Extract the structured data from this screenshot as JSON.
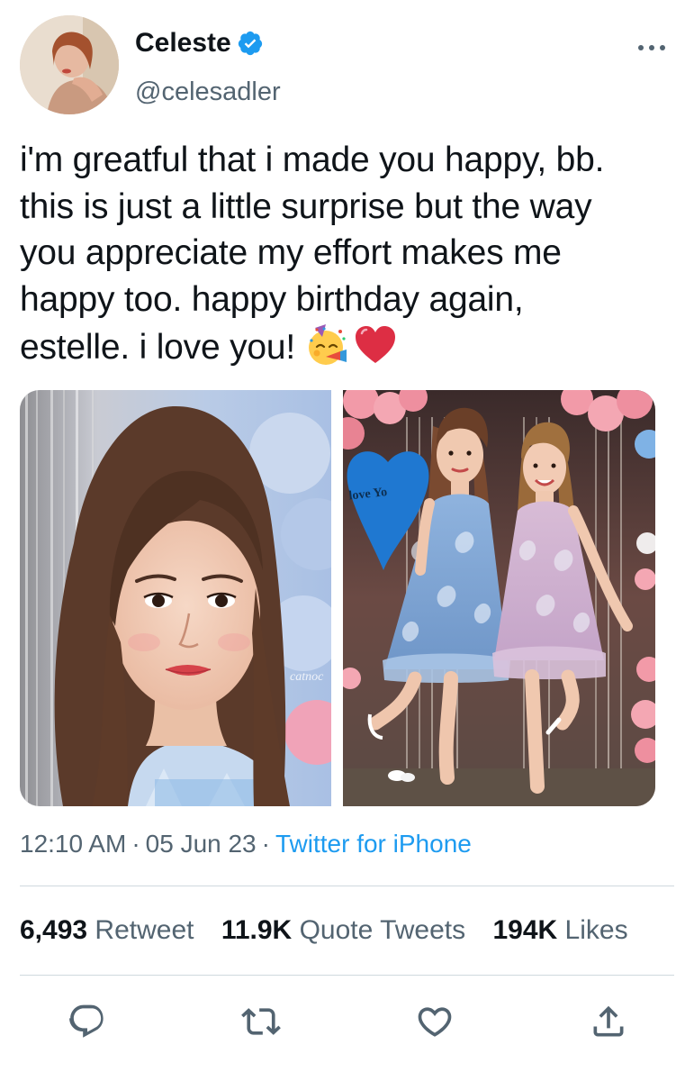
{
  "author": {
    "name": "Celeste",
    "handle": "@celesadler",
    "verified_color": "#1d9bf0"
  },
  "tweet": {
    "text_lines": [
      "i'm greatful that i made you happy, bb.",
      "this is just a little surprise but the way",
      "you appreciate my effort makes me",
      "happy too. happy birthday again,",
      "estelle. i love you!"
    ],
    "emojis": [
      "partying-face-emoji",
      "red-heart-emoji"
    ]
  },
  "media": {
    "left_watermark": "catnoc",
    "right_balloon_text": "love Yo"
  },
  "meta": {
    "time": "12:10 AM",
    "date": "05 Jun 23",
    "separator": "·",
    "source": "Twitter for iPhone"
  },
  "stats": {
    "retweets_count": "6,493",
    "retweets_label": "Retweet",
    "quotes_count": "11.9K",
    "quotes_label": "Quote Tweets",
    "likes_count": "194K",
    "likes_label": "Likes"
  },
  "actions": [
    "reply-icon",
    "retweet-icon",
    "like-icon",
    "share-icon"
  ],
  "colors": {
    "text": "#0f1419",
    "secondary": "#536471",
    "accent": "#1d9bf0",
    "divider": "#cfd9de"
  }
}
